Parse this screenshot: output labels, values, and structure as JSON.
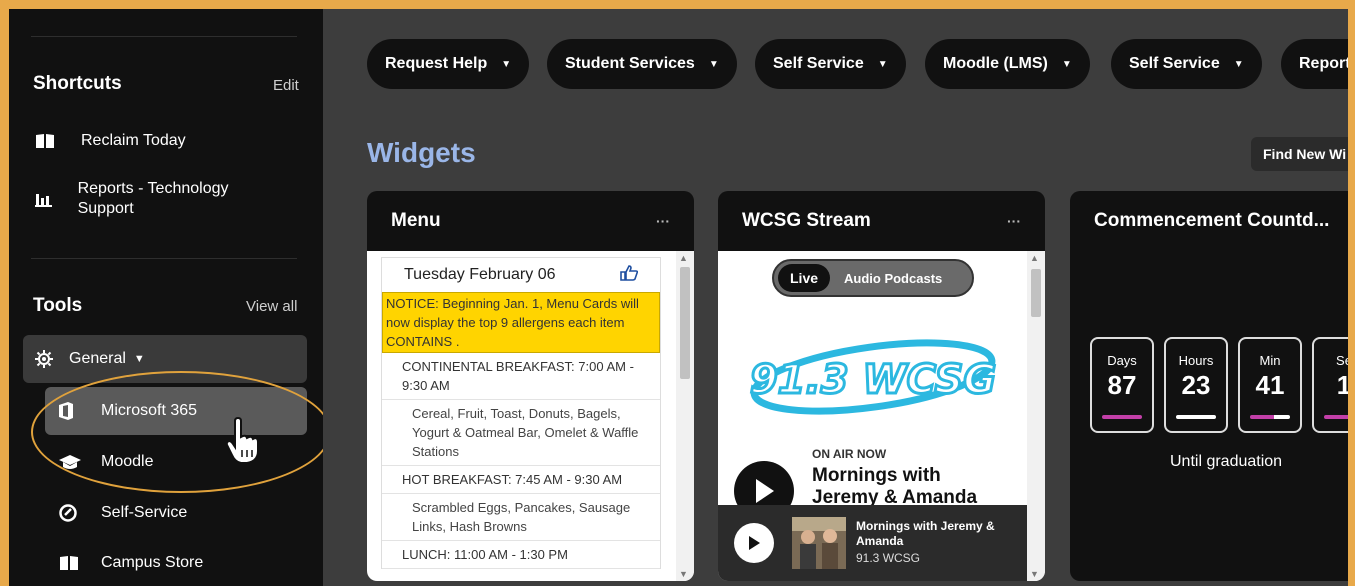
{
  "sidebar": {
    "shortcuts_title": "Shortcuts",
    "shortcuts_edit": "Edit",
    "shortcuts": [
      {
        "label": "Reclaim Today",
        "icon": "book-icon"
      },
      {
        "label": "Reports - Technology Support",
        "icon": "bar-chart-icon"
      }
    ],
    "tools_title": "Tools",
    "tools_view_all": "View all",
    "group_label": "General",
    "tools": [
      {
        "label": "Microsoft 365",
        "icon": "office-icon"
      },
      {
        "label": "Moodle",
        "icon": "graduation-cap-icon"
      },
      {
        "label": "Self-Service",
        "icon": "circle-check-icon"
      },
      {
        "label": "Campus Store",
        "icon": "book-icon"
      }
    ]
  },
  "nav_pills": [
    "Request Help",
    "Student Services",
    "Self Service",
    "Moodle (LMS)",
    "Self Service",
    "Report"
  ],
  "widgets": {
    "title": "Widgets",
    "find_new": "Find New Wi",
    "menu": {
      "title": "Menu",
      "more": "···",
      "date": "Tuesday February 06",
      "notice": "NOTICE: Beginning Jan. 1, Menu Cards will now display the top 9 allergens each item CONTAINS .",
      "meals": [
        {
          "name": "CONTINENTAL BREAKFAST: 7:00 AM - 9:30 AM",
          "items": "Cereal, Fruit, Toast, Donuts, Bagels, Yogurt & Oatmeal Bar, Omelet & Waffle Stations"
        },
        {
          "name": "HOT BREAKFAST: 7:45 AM - 9:30 AM",
          "items": "Scrambled Eggs, Pancakes, Sausage Links, Hash Browns"
        },
        {
          "name": "LUNCH: 11:00 AM - 1:30 PM",
          "items": ""
        }
      ]
    },
    "stream": {
      "title": "WCSG Stream",
      "more": "···",
      "tab_live": "Live",
      "tab_podcasts": "Audio Podcasts",
      "logo_text": "91.3 WCSG",
      "on_air": "ON AIR NOW",
      "show": "Mornings with Jeremy & Amanda",
      "player_title": "Mornings with Jeremy & Amanda",
      "player_sub": "91.3 WCSG"
    },
    "countdown": {
      "title": "Commencement Countd...",
      "units": [
        {
          "label": "Days",
          "value": "87",
          "bar": "#c23fa8"
        },
        {
          "label": "Hours",
          "value": "23",
          "bar": "#ffffff"
        },
        {
          "label": "Min",
          "value": "41",
          "bar": "#c23fa8"
        },
        {
          "label": "Se",
          "value": "1",
          "bar": "#c23fa8"
        }
      ],
      "caption": "Until graduation"
    }
  },
  "colors": {
    "accent_title": "#9ab6e8",
    "notice_bg": "#ffd400",
    "frame_border": "#e8a94a"
  }
}
